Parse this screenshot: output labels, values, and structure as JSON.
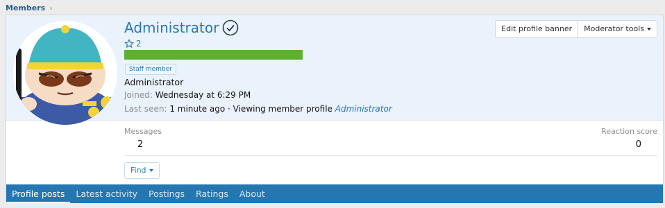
{
  "breadcrumb": {
    "label": "Members"
  },
  "profile": {
    "username": "Administrator",
    "rank_value": "2",
    "xp_fraction": 1.0,
    "badge": "Staff member",
    "role": "Administrator",
    "joined_label": "Joined:",
    "joined_value": "Wednesday at 6:29 PM",
    "lastseen_label": "Last seen:",
    "lastseen_value": "1 minute ago · Viewing member profile",
    "lastseen_link": "Administrator"
  },
  "actions": {
    "edit_banner": "Edit profile banner",
    "moderator_tools": "Moderator tools",
    "find": "Find"
  },
  "stats": {
    "messages_label": "Messages",
    "messages_value": "2",
    "reaction_label": "Reaction score",
    "reaction_value": "0"
  },
  "tabs": [
    {
      "label": "Profile posts",
      "active": true
    },
    {
      "label": "Latest activity",
      "active": false
    },
    {
      "label": "Postings",
      "active": false
    },
    {
      "label": "Ratings",
      "active": false
    },
    {
      "label": "About",
      "active": false
    }
  ],
  "colors": {
    "accent": "#2577b1",
    "xp_bar": "#5cb135",
    "banner_bg": "#eaf2fb"
  },
  "icons": {
    "breadcrumb_sep": "chevron-right-icon",
    "verified": "check-circle-icon",
    "rank": "star-outline-icon",
    "dropdown": "caret-down-icon"
  }
}
